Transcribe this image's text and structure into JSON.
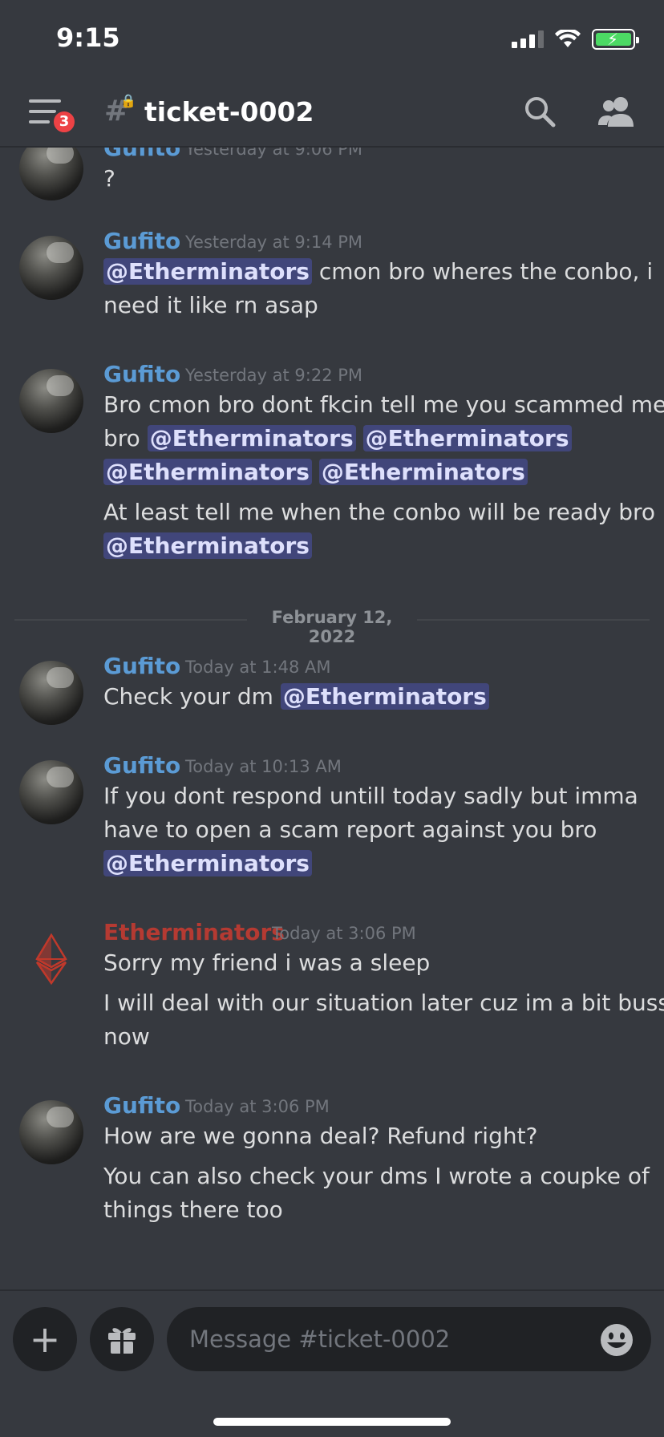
{
  "status_bar": {
    "time": "9:15"
  },
  "header": {
    "channel_name": "ticket-0002",
    "menu_badge": "3",
    "icons": [
      "hamburger-menu-icon",
      "locked-channel-hash-icon",
      "search-icon",
      "members-icon"
    ]
  },
  "messages": [
    {
      "author": "Gufito",
      "timestamp": "Yesterday at 9:06 PM",
      "lines": [
        {
          "text": "?"
        }
      ]
    },
    {
      "author": "Gufito",
      "timestamp": "Yesterday at 9:14 PM",
      "mention": "@Etherminators",
      "line1_rest": " cmon bro wheres the conbo, i",
      "line2": "need it like rn asap"
    },
    {
      "author": "Gufito",
      "timestamp": "Yesterday at 9:22 PM",
      "line1": "Bro cmon bro dont fkcin tell me you scammed me",
      "line2_prefix": "bro ",
      "mention": "@Etherminators",
      "line4": "At least tell me when the conbo will be ready bro"
    },
    {
      "date_divider": "February 12, 2022"
    },
    {
      "author": "Gufito",
      "timestamp": "Today at 1:48 AM",
      "line1_prefix": "Check your dm ",
      "mention": "@Etherminators"
    },
    {
      "author": "Gufito",
      "timestamp": "Today at 10:13 AM",
      "line1": "If you dont respond untill today sadly but imma",
      "line2": "have to open a scam report against you bro",
      "mention": "@Etherminators"
    },
    {
      "author": "Etherminators",
      "timestamp": "Today at 3:06 PM",
      "line1": "Sorry my friend i was a sleep",
      "line2": "I will deal with our situation later cuz im a bit bussy",
      "line3": "now"
    },
    {
      "author": "Gufito",
      "timestamp": "Today at 3:06 PM",
      "line1": "How are we gonna deal? Refund right?",
      "line2": "You can also check your dms I wrote a coupke of",
      "line3": "things there too"
    }
  ],
  "composer": {
    "placeholder": "Message #ticket-0002",
    "icons": [
      "plus-icon",
      "gift-icon",
      "emoji-icon"
    ]
  },
  "colors": {
    "background": "#36393f",
    "gufito_name": "#5b9bd5",
    "etherminators_name": "#b53a32",
    "mention_bg": "#41467a",
    "badge": "#ed4245"
  }
}
